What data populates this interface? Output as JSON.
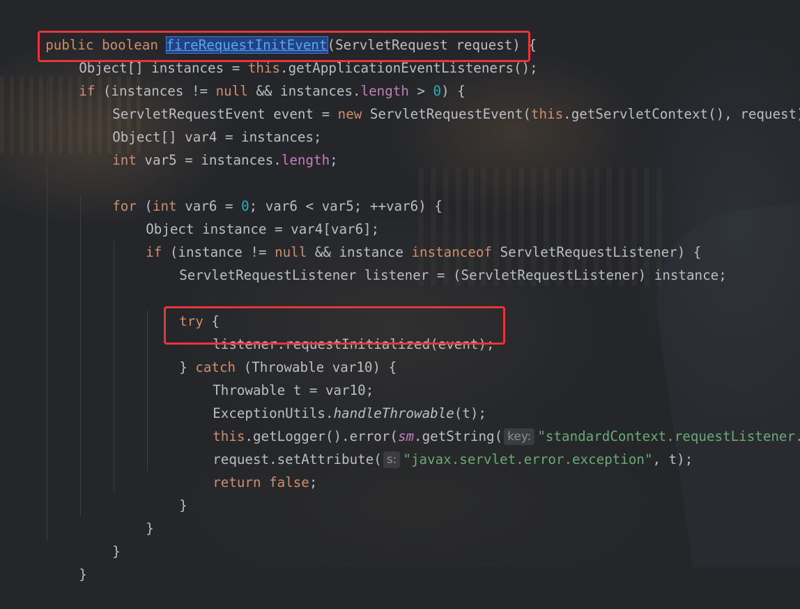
{
  "editor": {
    "method_name": "fireRequestInitEvent",
    "lines": {
      "l1_a": "public boolean ",
      "l1_b": "(ServletRequest request) {",
      "l2_a": "Object[] instances = ",
      "l2_b": "this",
      "l2_c": ".getApplicationEventListeners();",
      "l3_a": "if",
      "l3_b": " (instances != ",
      "l3_c": "null",
      "l3_d": " && instances.",
      "l3_e": "length",
      "l3_f": " > ",
      "l3_g": "0",
      "l3_h": ") {",
      "l4_a": "ServletRequestEvent event = ",
      "l4_b": "new",
      "l4_c": " ServletRequestEvent(",
      "l4_d": "this",
      "l4_e": ".getServletContext(), request);",
      "l5": "Object[] var4 = instances;",
      "l6_a": "int",
      "l6_b": " var5 = instances.",
      "l6_c": "length",
      "l6_d": ";",
      "l8_a": "for",
      "l8_b": " (",
      "l8_c": "int",
      "l8_d": " var6 = ",
      "l8_e": "0",
      "l8_f": "; var6 < var5; ++var6) {",
      "l9": "Object instance = var4[var6];",
      "l10_a": "if",
      "l10_b": " (instance != ",
      "l10_c": "null",
      "l10_d": " && instance ",
      "l10_e": "instanceof",
      "l10_f": " ServletRequestListener) {",
      "l11": "ServletRequestListener listener = (ServletRequestListener) instance;",
      "l13_a": "try",
      "l13_b": " {",
      "l14": "listener.requestInitialized(event);",
      "l15_a": "} ",
      "l15_b": "catch",
      "l15_c": " (Throwable var10) {",
      "l16": "Throwable t = var10;",
      "l17_a": "ExceptionUtils.",
      "l17_b": "handleThrowable",
      "l17_c": "(t);",
      "l18_a": "this",
      "l18_b": ".getLogger().error(",
      "l18_c": "sm",
      "l18_d": ".getString(",
      "l18_hint": "key:",
      "l18_e": "\"standardContext.requestListener.r",
      "l19_a": "request.setAttribute(",
      "l19_hint": "s:",
      "l19_b": "\"javax.servlet.error.exception\"",
      "l19_c": ", t);",
      "l20_a": "return",
      "l20_b": " ",
      "l20_c": "false",
      "l20_d": ";",
      "l21": "}",
      "l22": "}",
      "l23": "}",
      "l24": "}"
    }
  },
  "colors": {
    "background": "#24262a",
    "text": "#bcbec4",
    "keyword": "#cf8e6d",
    "number": "#2aacb8",
    "field": "#c77dbb",
    "string": "#6aab73",
    "highlight_box": "#e8353a"
  }
}
